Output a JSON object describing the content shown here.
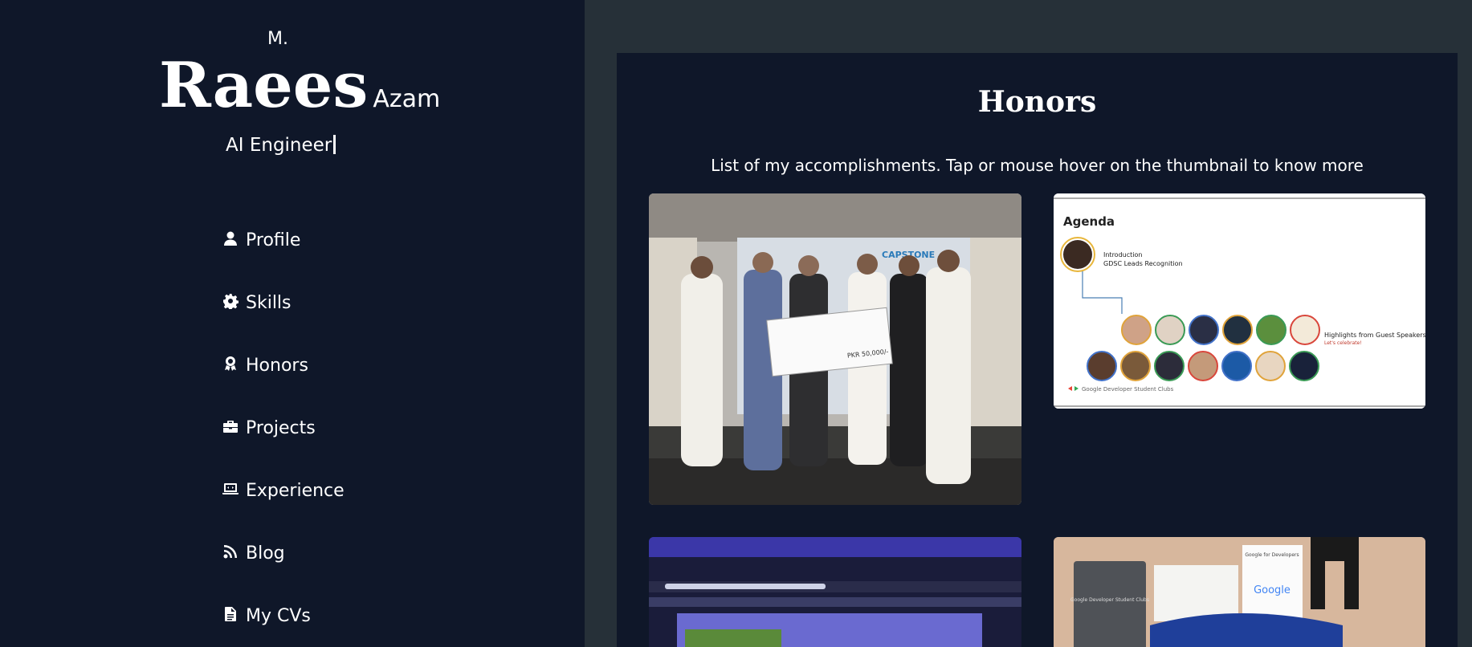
{
  "profile": {
    "first": "M.",
    "last": "Raees",
    "surname": "Azam",
    "role": "AI Engineer"
  },
  "nav": [
    {
      "label": "Profile",
      "icon": "user-icon"
    },
    {
      "label": "Skills",
      "icon": "gear-icon"
    },
    {
      "label": "Honors",
      "icon": "award-icon"
    },
    {
      "label": "Projects",
      "icon": "briefcase-icon"
    },
    {
      "label": "Experience",
      "icon": "laptop-icon"
    },
    {
      "label": "Blog",
      "icon": "rss-icon"
    },
    {
      "label": "My CVs",
      "icon": "document-icon"
    }
  ],
  "honors": {
    "title": "Honors",
    "subtitle": "List of my accomplishments. Tap or mouse hover on the thumbnail to know more",
    "cards": [
      {
        "name": "award-cheque-photo",
        "banner": "CAPSTONE",
        "cheque": "PKR 50,000/-"
      },
      {
        "name": "gdsc-agenda-slide",
        "title": "Agenda",
        "line1": "Introduction",
        "line2": "GDSC Leads Recognition",
        "speakers": "Highlights from Guest Speakers",
        "speakers_sub": "Let's celebrate!",
        "footer": "Google Developer Student Clubs"
      },
      {
        "name": "laptop-screen-photo"
      },
      {
        "name": "google-swag-photo",
        "card1": "Google Developer Student Clubs",
        "card2": "Google for Developers",
        "brand": "Google"
      }
    ]
  },
  "colors": {
    "page_bg": "#263038",
    "panel_bg": "#0f1729",
    "text": "#ffffff"
  }
}
